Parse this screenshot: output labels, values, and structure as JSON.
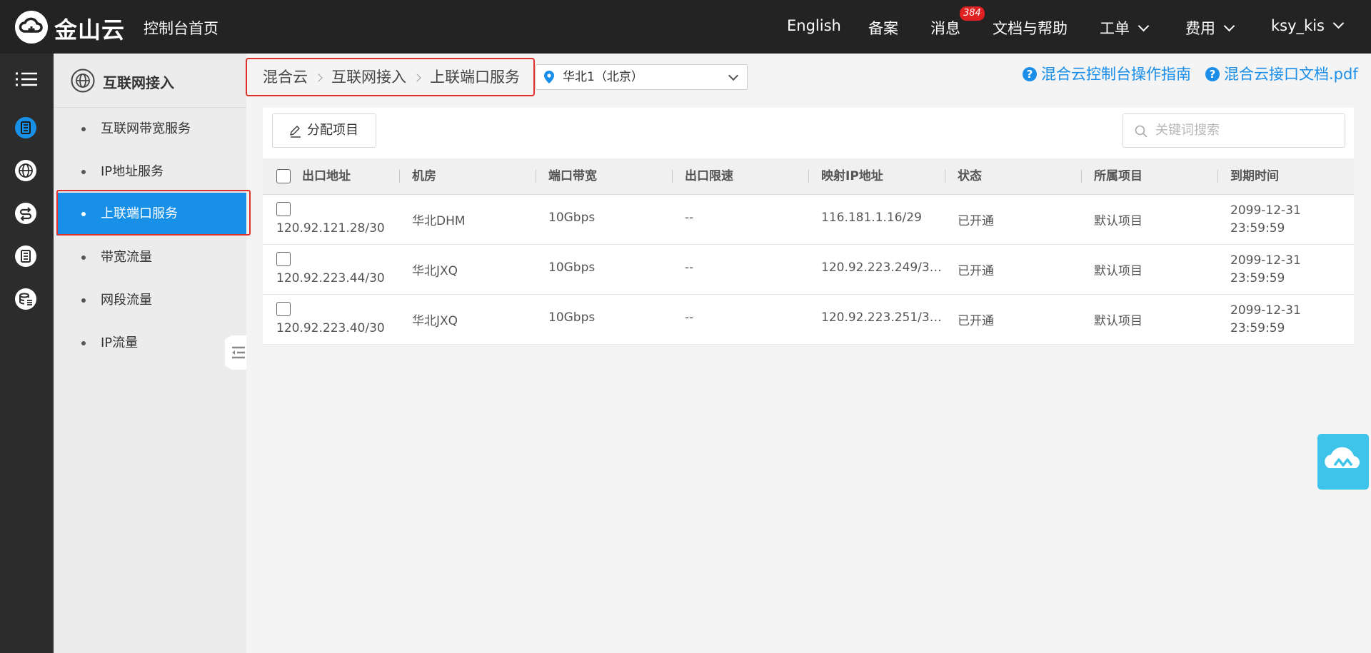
{
  "topbar": {
    "brand": "金山云",
    "home_link": "控制台首页",
    "nav": {
      "english": "English",
      "beian": "备案",
      "messages": "消息",
      "messages_badge": "384",
      "docs": "文档与帮助",
      "tickets": "工单",
      "billing": "费用",
      "user": "ksy_kis"
    }
  },
  "rail": {
    "icons": [
      "menu-icon",
      "server-icon",
      "globe-icon",
      "cloud-switch-icon",
      "document-icon",
      "database-icon"
    ],
    "accent": "#1890e8"
  },
  "sidebar": {
    "title": "互联网接入",
    "items": [
      {
        "label": "互联网带宽服务"
      },
      {
        "label": "IP地址服务"
      },
      {
        "label": "上联端口服务"
      },
      {
        "label": "带宽流量"
      },
      {
        "label": "网段流量"
      },
      {
        "label": "IP流量"
      }
    ],
    "active_item": "上联端口服务"
  },
  "breadcrumb": {
    "items": [
      "混合云",
      "互联网接入",
      "上联端口服务"
    ]
  },
  "region": {
    "selected": "华北1（北京）"
  },
  "help_links": [
    {
      "label": "混合云控制台操作指南"
    },
    {
      "label": "混合云接口文档.pdf"
    }
  ],
  "toolbar": {
    "assign_label": "分配项目",
    "search_placeholder": "关键词搜索"
  },
  "table": {
    "columns": [
      "出口地址",
      "机房",
      "端口带宽",
      "出口限速",
      "映射IP地址",
      "状态",
      "所属项目",
      "到期时间"
    ],
    "rows": [
      {
        "exit_address": "120.92.121.28/30",
        "room": "华北DHM",
        "bandwidth": "10Gbps",
        "rate_limit": "--",
        "mapped_ip": "116.181.1.16/29",
        "status": "已开通",
        "project": "默认项目",
        "expire_date": "2099-12-31",
        "expire_time": "23:59:59"
      },
      {
        "exit_address": "120.92.223.44/30",
        "room": "华北JXQ",
        "bandwidth": "10Gbps",
        "rate_limit": "--",
        "mapped_ip": "120.92.223.249/3…",
        "status": "已开通",
        "project": "默认项目",
        "expire_date": "2099-12-31",
        "expire_time": "23:59:59"
      },
      {
        "exit_address": "120.92.223.40/30",
        "room": "华北JXQ",
        "bandwidth": "10Gbps",
        "rate_limit": "--",
        "mapped_ip": "120.92.223.251/3…",
        "status": "已开通",
        "project": "默认项目",
        "expire_date": "2099-12-31",
        "expire_time": "23:59:59"
      }
    ]
  },
  "colors": {
    "topbar_bg": "#232323",
    "sidebar_active": "#1890e8",
    "link_blue": "#1a8ee8",
    "highlight_red": "#e0302c",
    "badge_red": "#e02020"
  }
}
